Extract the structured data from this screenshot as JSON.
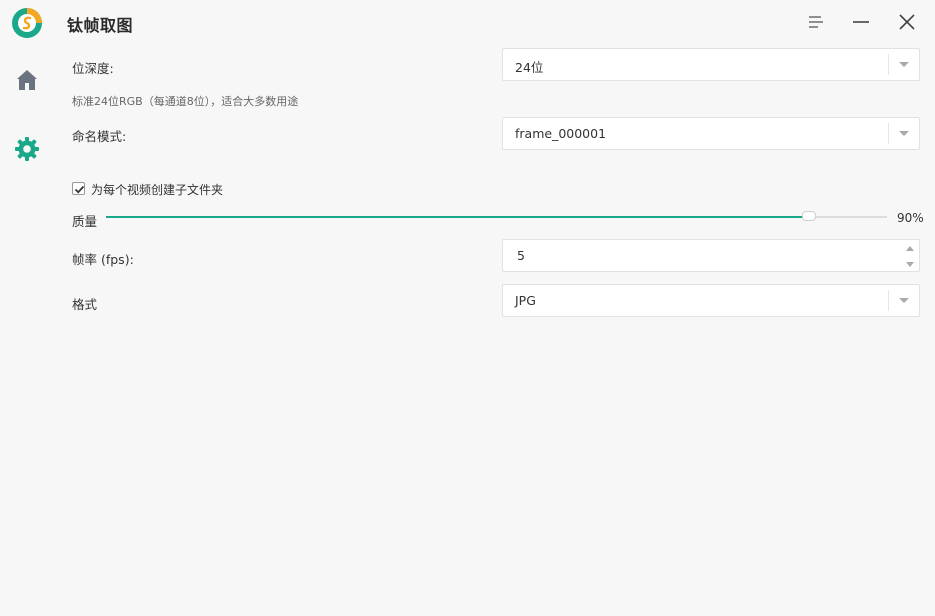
{
  "app": {
    "title": "钛帧取图"
  },
  "colors": {
    "accent": "#1aa88a",
    "logo_green": "#1aa88a",
    "logo_orange": "#f5a623"
  },
  "sidebar": {
    "items": [
      {
        "name": "home",
        "icon": "home-icon"
      },
      {
        "name": "settings",
        "icon": "gear-icon",
        "active": true
      }
    ]
  },
  "window_controls": [
    "menu-icon",
    "minimize-icon",
    "close-icon"
  ],
  "settings": {
    "bit_depth": {
      "label": "位深度:",
      "value": "24位",
      "hint": "标准24位RGB（每通道8位），适合大多数用途"
    },
    "naming": {
      "label": "命名模式:",
      "value": "frame_000001"
    },
    "subfolder": {
      "label": "为每个视频创建子文件夹",
      "checked": true
    },
    "quality": {
      "label": "质量",
      "value": 90,
      "display": "90%"
    },
    "fps": {
      "label": "帧率 (fps):",
      "value": "5"
    },
    "format": {
      "label": "格式",
      "value": "JPG"
    }
  }
}
